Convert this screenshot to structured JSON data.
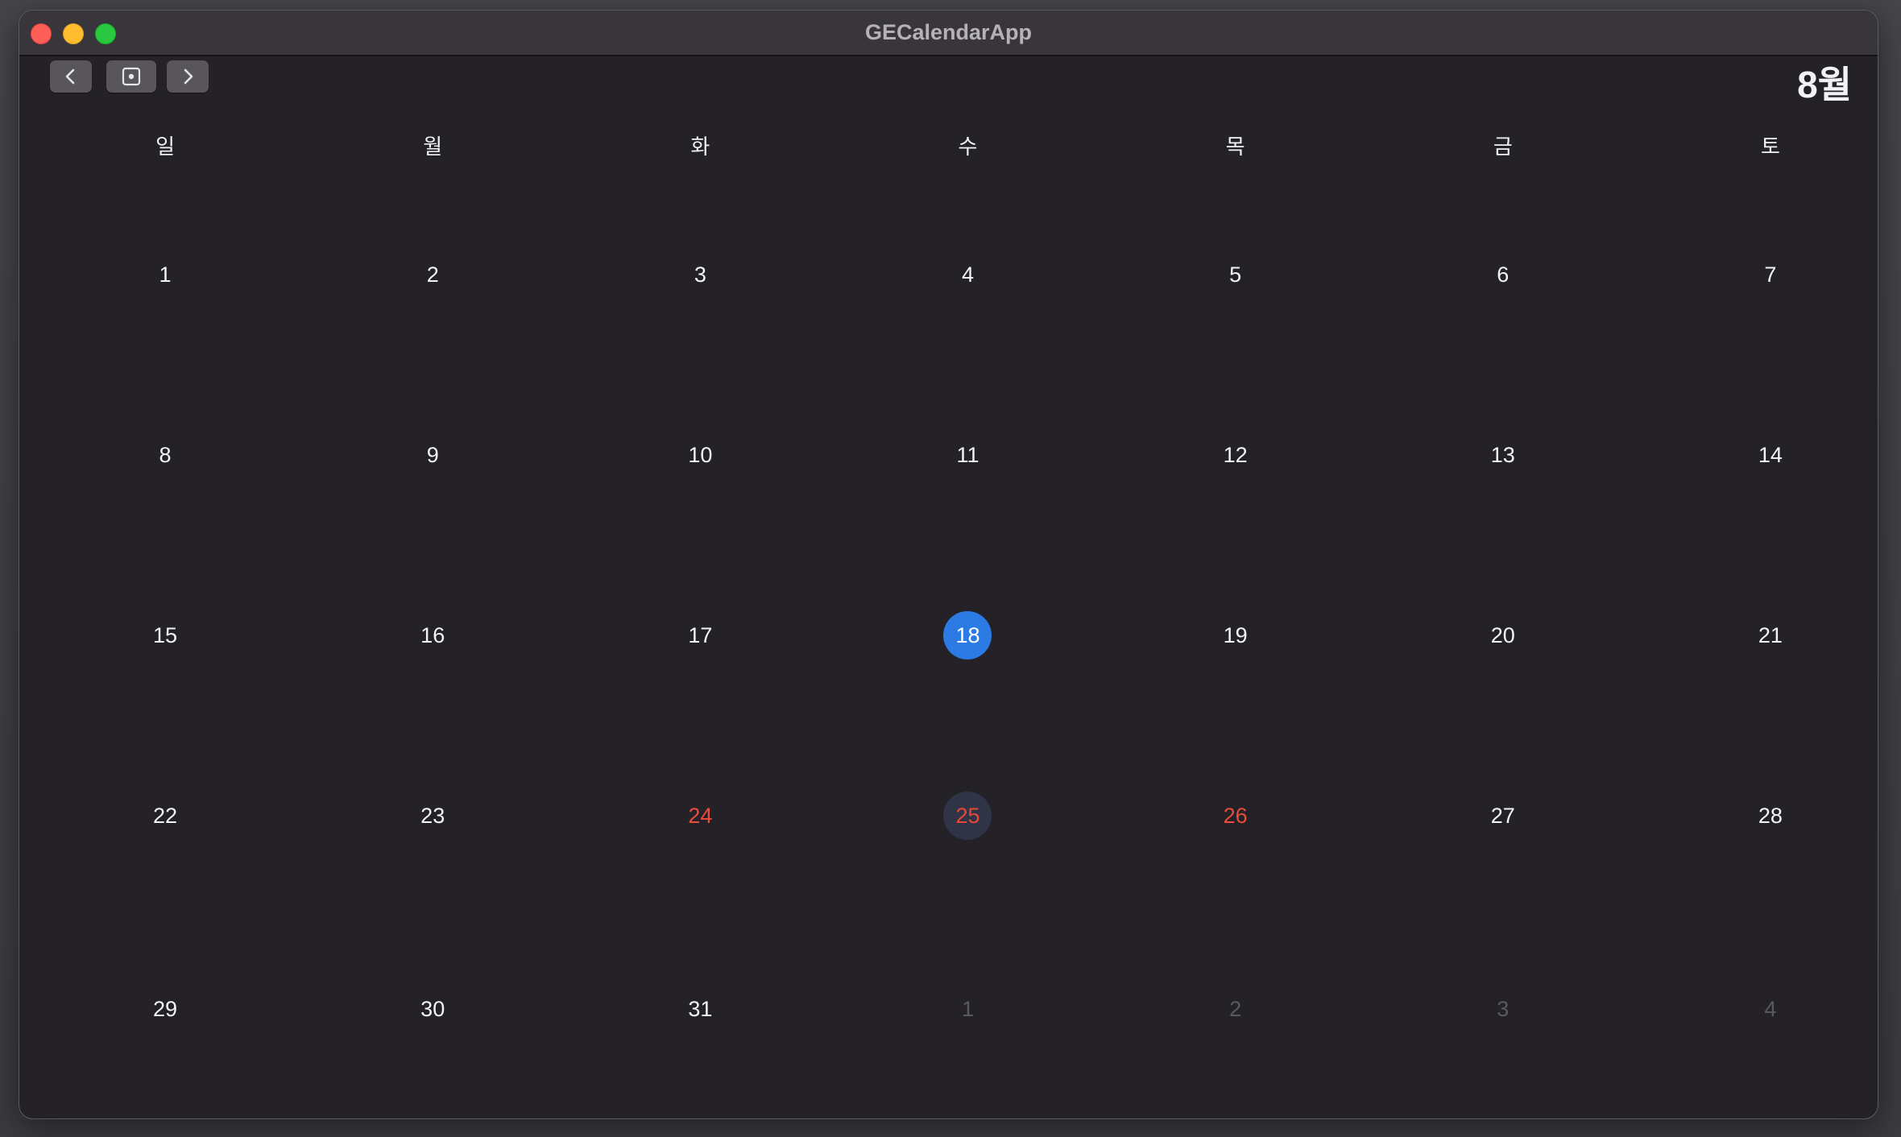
{
  "window": {
    "title": "GECalendarApp"
  },
  "toolbar": {
    "prev_icon": "chevron-left-icon",
    "today_icon": "today-dot-icon",
    "next_icon": "chevron-right-icon"
  },
  "header": {
    "month": "8월"
  },
  "weekdays": [
    "일",
    "월",
    "화",
    "수",
    "목",
    "금",
    "토"
  ],
  "colors": {
    "today": "#2c7be5",
    "selected": "#2f3446",
    "holiday": "#ea4b3f",
    "faded": "#5a5960",
    "background": "#242127"
  },
  "weeks": [
    [
      {
        "d": "1"
      },
      {
        "d": "2"
      },
      {
        "d": "3"
      },
      {
        "d": "4"
      },
      {
        "d": "5"
      },
      {
        "d": "6"
      },
      {
        "d": "7"
      }
    ],
    [
      {
        "d": "8"
      },
      {
        "d": "9"
      },
      {
        "d": "10"
      },
      {
        "d": "11"
      },
      {
        "d": "12"
      },
      {
        "d": "13"
      },
      {
        "d": "14"
      }
    ],
    [
      {
        "d": "15"
      },
      {
        "d": "16"
      },
      {
        "d": "17"
      },
      {
        "d": "18",
        "state": "today"
      },
      {
        "d": "19"
      },
      {
        "d": "20"
      },
      {
        "d": "21"
      }
    ],
    [
      {
        "d": "22"
      },
      {
        "d": "23"
      },
      {
        "d": "24",
        "state": "holiday"
      },
      {
        "d": "25",
        "state": "selected"
      },
      {
        "d": "26",
        "state": "holiday"
      },
      {
        "d": "27"
      },
      {
        "d": "28"
      }
    ],
    [
      {
        "d": "29"
      },
      {
        "d": "30"
      },
      {
        "d": "31"
      },
      {
        "d": "1",
        "state": "faded"
      },
      {
        "d": "2",
        "state": "faded"
      },
      {
        "d": "3",
        "state": "faded"
      },
      {
        "d": "4",
        "state": "faded"
      }
    ]
  ]
}
